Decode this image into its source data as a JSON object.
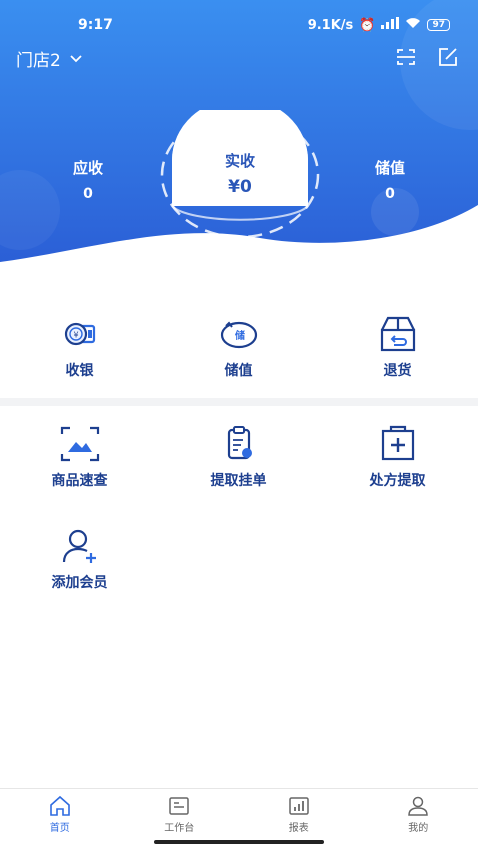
{
  "status_bar": {
    "time": "9:17",
    "network_speed": "9.1K/s",
    "battery": "97"
  },
  "header": {
    "store_name": "门店2"
  },
  "stats": {
    "receivable": {
      "label": "应收",
      "value": "0"
    },
    "received": {
      "label": "实收",
      "value": "¥0"
    },
    "stored_value": {
      "label": "储值",
      "value": "0"
    }
  },
  "actions_row1": [
    {
      "label": "收银",
      "icon": "cash-icon"
    },
    {
      "label": "储值",
      "icon": "piggy-bank-icon"
    },
    {
      "label": "退货",
      "icon": "return-box-icon"
    }
  ],
  "actions_row2": [
    {
      "label": "商品速查",
      "icon": "scan-image-icon"
    },
    {
      "label": "提取挂单",
      "icon": "clipboard-icon"
    },
    {
      "label": "处方提取",
      "icon": "medical-kit-icon"
    }
  ],
  "actions_row3": [
    {
      "label": "添加会员",
      "icon": "add-user-icon"
    }
  ],
  "bottom_nav": [
    {
      "label": "首页",
      "icon": "home-icon",
      "active": true
    },
    {
      "label": "工作台",
      "icon": "workbench-icon",
      "active": false
    },
    {
      "label": "报表",
      "icon": "chart-icon",
      "active": false
    },
    {
      "label": "我的",
      "icon": "profile-icon",
      "active": false
    }
  ],
  "colors": {
    "primary": "#2f6be0",
    "hero_top": "#3a8ff0",
    "hero_bottom": "#2b5fd6",
    "text_dark_blue": "#1d3f8f"
  }
}
